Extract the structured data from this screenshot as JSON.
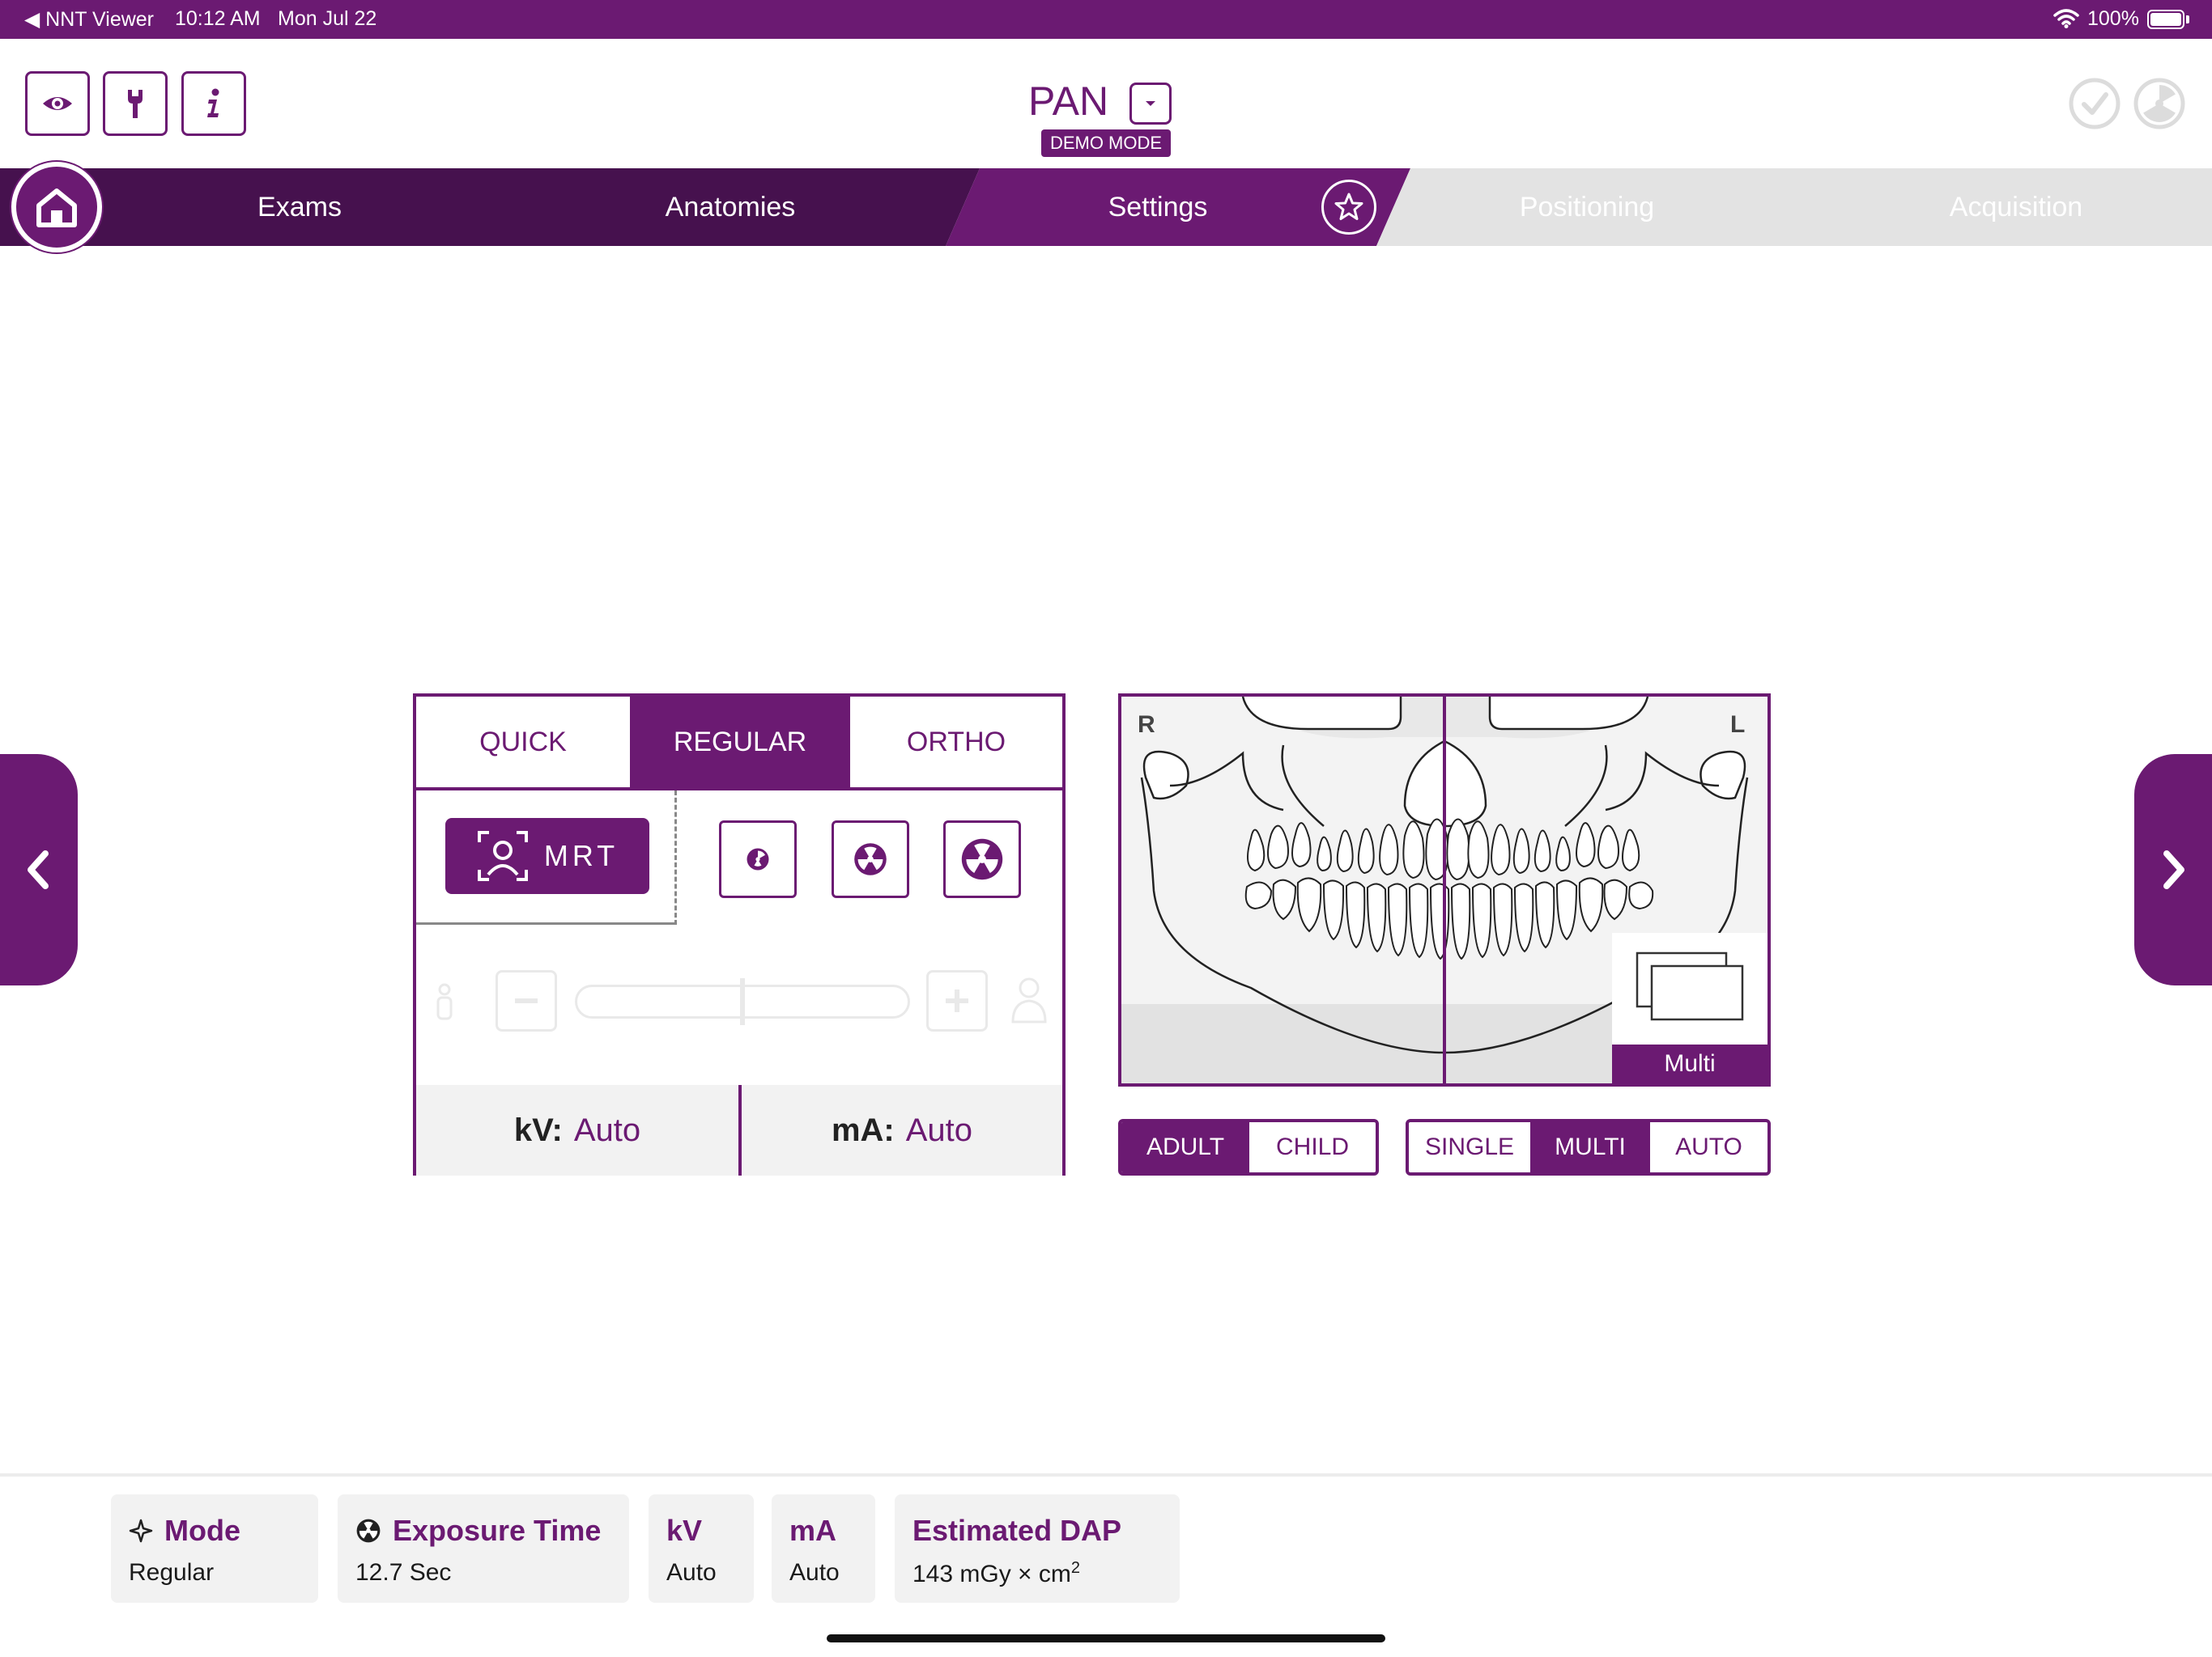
{
  "status_bar": {
    "back_app": "◀ NNT Viewer",
    "time": "10:12 AM",
    "date": "Mon Jul 22",
    "battery": "100%"
  },
  "header": {
    "title": "PAN",
    "demo_badge": "DEMO MODE"
  },
  "nav": {
    "tabs": [
      "Exams",
      "Anatomies",
      "Settings",
      "Positioning",
      "Acquisition"
    ],
    "active": "Settings"
  },
  "mode_panel": {
    "tabs": [
      "QUICK",
      "REGULAR",
      "ORTHO"
    ],
    "active_tab": "REGULAR",
    "mrt_label": "MRT",
    "kv_label": "kV:",
    "kv_value": "Auto",
    "ma_label": "mA:",
    "ma_value": "Auto"
  },
  "xray": {
    "right_marker": "R",
    "left_marker": "L",
    "multi_label": "Multi"
  },
  "patient_toggle": {
    "options": [
      "ADULT",
      "CHILD"
    ],
    "selected": "ADULT"
  },
  "image_toggle": {
    "options": [
      "SINGLE",
      "MULTI",
      "AUTO"
    ],
    "selected": "MULTI"
  },
  "summary": {
    "mode_title": "Mode",
    "mode_value": "Regular",
    "exposure_title": "Exposure Time",
    "exposure_value": "12.7 Sec",
    "kv_title": "kV",
    "kv_value": "Auto",
    "ma_title": "mA",
    "ma_value": "Auto",
    "dap_title": "Estimated DAP",
    "dap_value": "143 mGy × cm",
    "dap_exp": "2"
  },
  "colors": {
    "accent": "#6b1a72",
    "nav_dark": "#46114e",
    "nav_disabled": "#e3e3e3"
  }
}
